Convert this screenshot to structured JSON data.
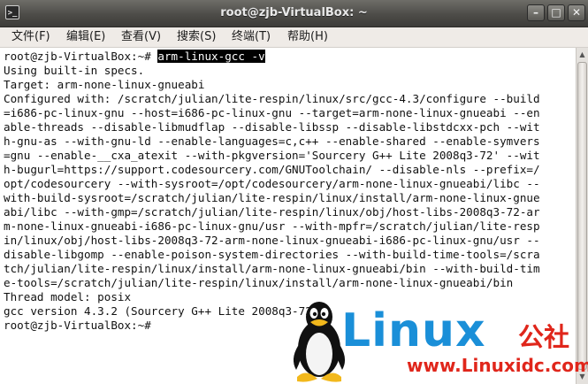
{
  "window": {
    "title": "root@zjb-VirtualBox: ~",
    "icon_glyph": ">_",
    "minimize_glyph": "–",
    "maximize_glyph": "□",
    "close_glyph": "✕"
  },
  "menu": {
    "items": [
      {
        "label": "文件(F)"
      },
      {
        "label": "编辑(E)"
      },
      {
        "label": "查看(V)"
      },
      {
        "label": "搜索(S)"
      },
      {
        "label": "终端(T)"
      },
      {
        "label": "帮助(H)"
      }
    ]
  },
  "terminal": {
    "prompt": "root@zjb-VirtualBox:~# ",
    "command": "arm-linux-gcc -v",
    "lines": [
      "Using built-in specs.",
      "Target: arm-none-linux-gnueabi",
      "Configured with: /scratch/julian/lite-respin/linux/src/gcc-4.3/configure --build",
      "=i686-pc-linux-gnu --host=i686-pc-linux-gnu --target=arm-none-linux-gnueabi --en",
      "able-threads --disable-libmudflap --disable-libssp --disable-libstdcxx-pch --wit",
      "h-gnu-as --with-gnu-ld --enable-languages=c,c++ --enable-shared --enable-symvers",
      "=gnu --enable-__cxa_atexit --with-pkgversion='Sourcery G++ Lite 2008q3-72' --wit",
      "h-bugurl=https://support.codesourcery.com/GNUToolchain/ --disable-nls --prefix=/",
      "opt/codesourcery --with-sysroot=/opt/codesourcery/arm-none-linux-gnueabi/libc --",
      "with-build-sysroot=/scratch/julian/lite-respin/linux/install/arm-none-linux-gnue",
      "abi/libc --with-gmp=/scratch/julian/lite-respin/linux/obj/host-libs-2008q3-72-ar",
      "m-none-linux-gnueabi-i686-pc-linux-gnu/usr --with-mpfr=/scratch/julian/lite-resp",
      "in/linux/obj/host-libs-2008q3-72-arm-none-linux-gnueabi-i686-pc-linux-gnu/usr --",
      "disable-libgomp --enable-poison-system-directories --with-build-time-tools=/scra",
      "tch/julian/lite-respin/linux/install/arm-none-linux-gnueabi/bin --with-build-tim",
      "e-tools=/scratch/julian/lite-respin/linux/install/arm-none-linux-gnueabi/bin",
      "Thread model: posix",
      "gcc version 4.3.2 (Sourcery G++ Lite 2008q3-72)"
    ],
    "final_prompt": "root@zjb-VirtualBox:~# "
  },
  "watermark": {
    "brand": "Linux",
    "brand_cn": "公社",
    "url": "www.Linuxidc.com"
  },
  "colors": {
    "titlebar": "#4d4c48",
    "menubar": "#efebe7",
    "terminal_bg": "#ffffff",
    "terminal_fg": "#111111",
    "watermark_blue": "#1a8fd8",
    "watermark_red": "#e0261b"
  }
}
